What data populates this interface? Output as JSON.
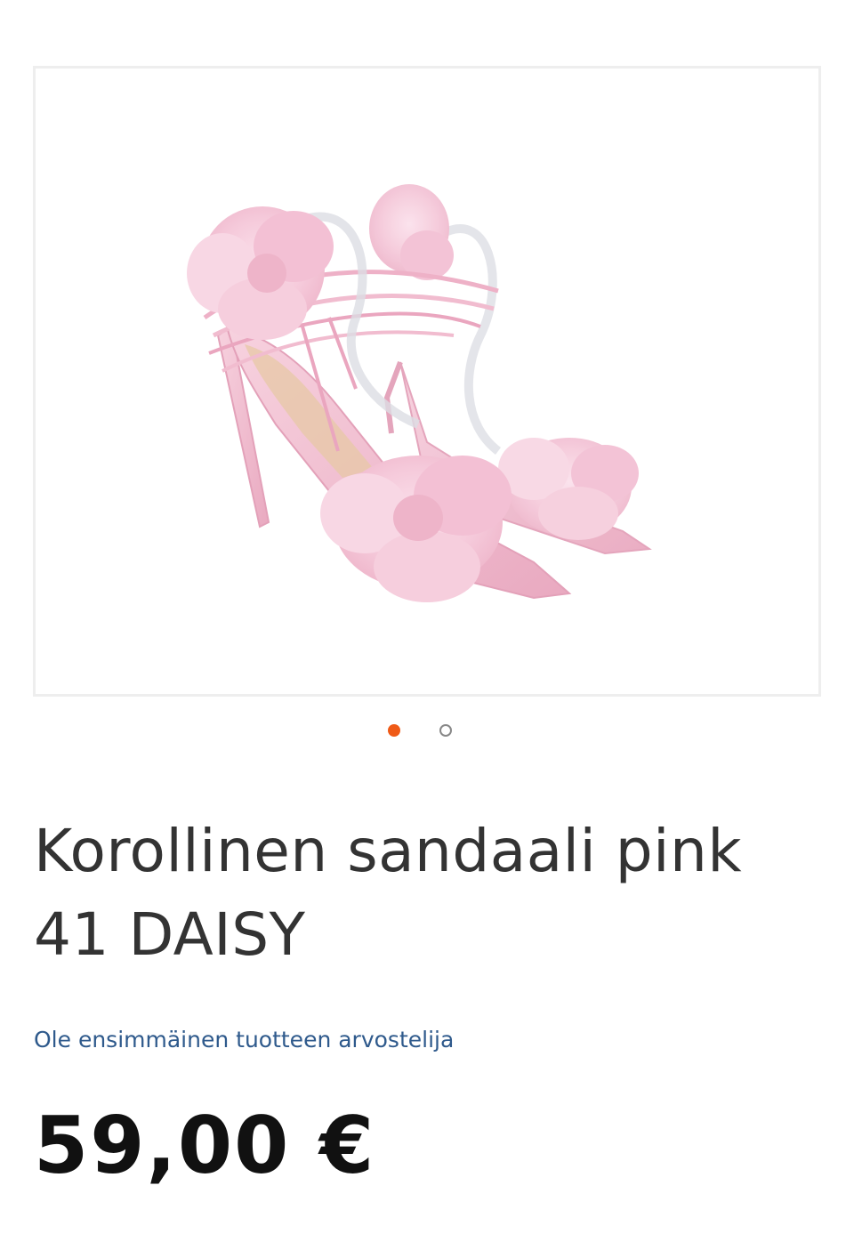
{
  "product": {
    "title": "Korollinen sandaali pink 41 DAISY",
    "review_link": "Ole ensimmäinen tuotteen arvostelija",
    "price": "59,00 €"
  },
  "gallery": {
    "image_count": 2,
    "active_index": 0,
    "image_subject": "pink flower heeled sandals",
    "colors": {
      "active_dot": "#ef5a17",
      "inactive_dot": "#888888",
      "shoe_pink": "#f4c3d6",
      "link": "#2f5a8c"
    }
  }
}
